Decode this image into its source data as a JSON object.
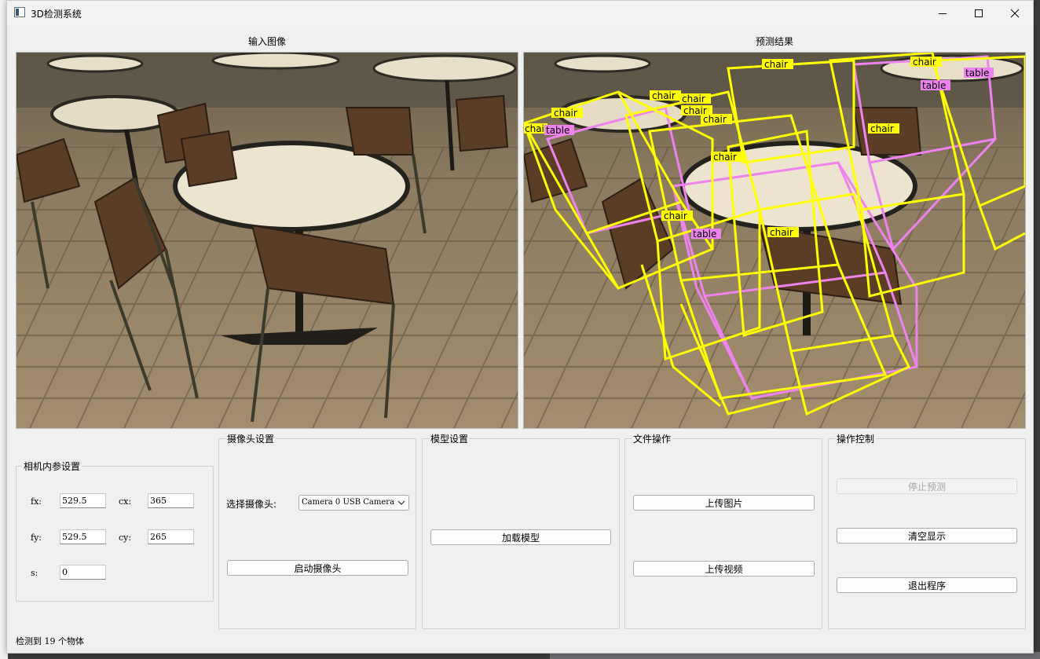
{
  "window": {
    "title": "3D检测系统",
    "minimize_icon": "minimize-icon",
    "maximize_icon": "maximize-icon",
    "close_icon": "close-icon"
  },
  "input_panel": {
    "caption": "输入图像"
  },
  "result_panel": {
    "caption": "预测结果",
    "detections": [
      {
        "label": "chair",
        "color": "#ffff00"
      },
      {
        "label": "chair",
        "color": "#ffff00"
      },
      {
        "label": "chair",
        "color": "#ffff00"
      },
      {
        "label": "chair",
        "color": "#ffff00"
      },
      {
        "label": "chair",
        "color": "#ffff00"
      },
      {
        "label": "chair",
        "color": "#ffff00"
      },
      {
        "label": "chair",
        "color": "#ffff00"
      },
      {
        "label": "chair",
        "color": "#ffff00"
      },
      {
        "label": "chair",
        "color": "#ffff00"
      },
      {
        "label": "chair",
        "color": "#ffff00"
      },
      {
        "label": "chair",
        "color": "#ffff00"
      },
      {
        "label": "table",
        "color": "#ee82ee"
      },
      {
        "label": "table",
        "color": "#ee82ee"
      },
      {
        "label": "table",
        "color": "#ee82ee"
      },
      {
        "label": "table",
        "color": "#ee82ee"
      },
      {
        "label": "table",
        "color": "#ee82ee"
      }
    ]
  },
  "camera_intrinsics": {
    "title": "相机内参设置",
    "fx_label": "fx:",
    "fx_value": "529.5",
    "cx_label": "cx:",
    "cx_value": "365",
    "fy_label": "fy:",
    "fy_value": "529.5",
    "cy_label": "cy:",
    "cy_value": "265",
    "s_label": "s:",
    "s_value": "0"
  },
  "camera_settings": {
    "title": "摄像头设置",
    "select_label": "选择摄像头:",
    "select_value": "Camera 0 USB Camera",
    "start_button": "启动摄像头"
  },
  "model_settings": {
    "title": "模型设置",
    "load_button": "加载模型"
  },
  "file_ops": {
    "title": "文件操作",
    "upload_image_button": "上传图片",
    "upload_video_button": "上传视频"
  },
  "control": {
    "title": "操作控制",
    "stop_button": "停止预测",
    "clear_button": "清空显示",
    "exit_button": "退出程序"
  },
  "status_bar": {
    "text": "检测到 19 个物体"
  },
  "colors": {
    "chair_box": "#ffff00",
    "table_box": "#ee82ee",
    "window_bg": "#f0f0f0"
  }
}
